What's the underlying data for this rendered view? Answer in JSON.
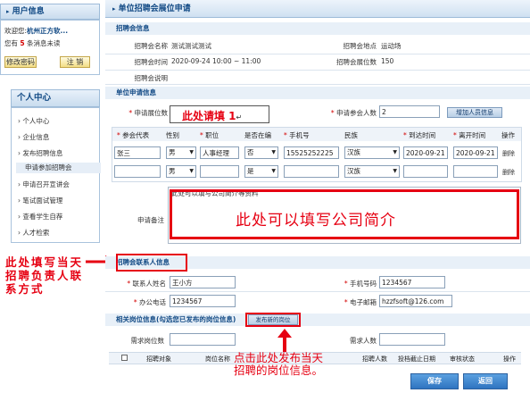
{
  "sidebar": {
    "user_info_title": "用户信息",
    "welcome": "欢迎您:",
    "org_name": "杭州正方软...",
    "msg_prefix": "您有",
    "msg_count": "5",
    "msg_suffix": "条消息未读",
    "change_pwd_label": "修改密码",
    "logout_label": "注 销",
    "personal_center_title": "个人中心",
    "menu": [
      {
        "label": "个人中心"
      },
      {
        "label": "企业信息"
      },
      {
        "label": "发布招聘信息"
      },
      {
        "label": "申请参加招聘会"
      },
      {
        "label": "申请召开宣讲会"
      },
      {
        "label": "笔试面试管理"
      },
      {
        "label": "查看学生自荐"
      },
      {
        "label": "人才检索"
      }
    ]
  },
  "header": {
    "title": "单位招聘会展位申请"
  },
  "fair_info": {
    "section_title": "招聘会信息",
    "name_label": "招聘会名称",
    "name_value": "测试测试测试",
    "location_label": "招聘会地点",
    "location_value": "运动场",
    "time_label": "招聘会时间",
    "time_value": "2020-09-24 10:00 ~ 11:00",
    "booths_label": "招聘会展位数",
    "booths_value": "150",
    "desc_label": "招聘会说明"
  },
  "apply_info": {
    "section_title": "单位申请信息",
    "booth_count_label": "申请展位数",
    "attendee_count_label": "申请参会人数",
    "attendee_count_value": "2",
    "add_person_label": "增加人员信息",
    "table_headers": [
      "参会代表",
      "性别",
      "职位",
      "是否在编",
      "手机号",
      "民族",
      "到达时间",
      "离开时间",
      "操作"
    ],
    "rows": [
      {
        "name": "张三",
        "gender": "男",
        "position": "人事经理",
        "staffed": "否",
        "phone": "15525252225",
        "ethnicity": "汉族",
        "arrive": "2020-09-21",
        "leave": "2020-09-21",
        "op": "删除"
      },
      {
        "name": "",
        "gender": "男",
        "position": "",
        "staffed": "是",
        "phone": "",
        "ethnicity": "汉族",
        "arrive": "",
        "leave": "",
        "op": "删除"
      }
    ],
    "remark_label": "申请备注",
    "remark_text": "此处可以填写公司简介等资料"
  },
  "contact_info": {
    "section_title": "招聘会联系人信息",
    "name_label": "联系人姓名",
    "name_value": "王小方",
    "mobile_label": "手机号码",
    "mobile_value": "1234567",
    "office_phone_label": "办公电话",
    "office_phone_value": "1234567",
    "email_label": "电子邮箱",
    "email_value": "hzzfsoft@126.com"
  },
  "job_info": {
    "section_title": "相关岗位信息(勾选您已发布的岗位信息)",
    "publish_new_label": "发布新的岗位",
    "need_position_label": "需求岗位数",
    "need_people_label": "需求人数",
    "table_headers": [
      "招聘对象",
      "岗位名称",
      "招聘人数",
      "投档截止日期",
      "审核状态",
      "操作"
    ]
  },
  "buttons": {
    "save": "保存",
    "back": "返回"
  },
  "annotations": {
    "fill_here": "此处请填 1",
    "fill_intro": "此处可以填写公司简介",
    "fill_contact": "此处填写当天招聘负责人联系方式",
    "click_publish": "点击此处发布当天招聘的岗位信息。"
  },
  "colors": {
    "accent": "#124a85",
    "annotation_red": "#e60012",
    "required_star": "#d40000"
  }
}
